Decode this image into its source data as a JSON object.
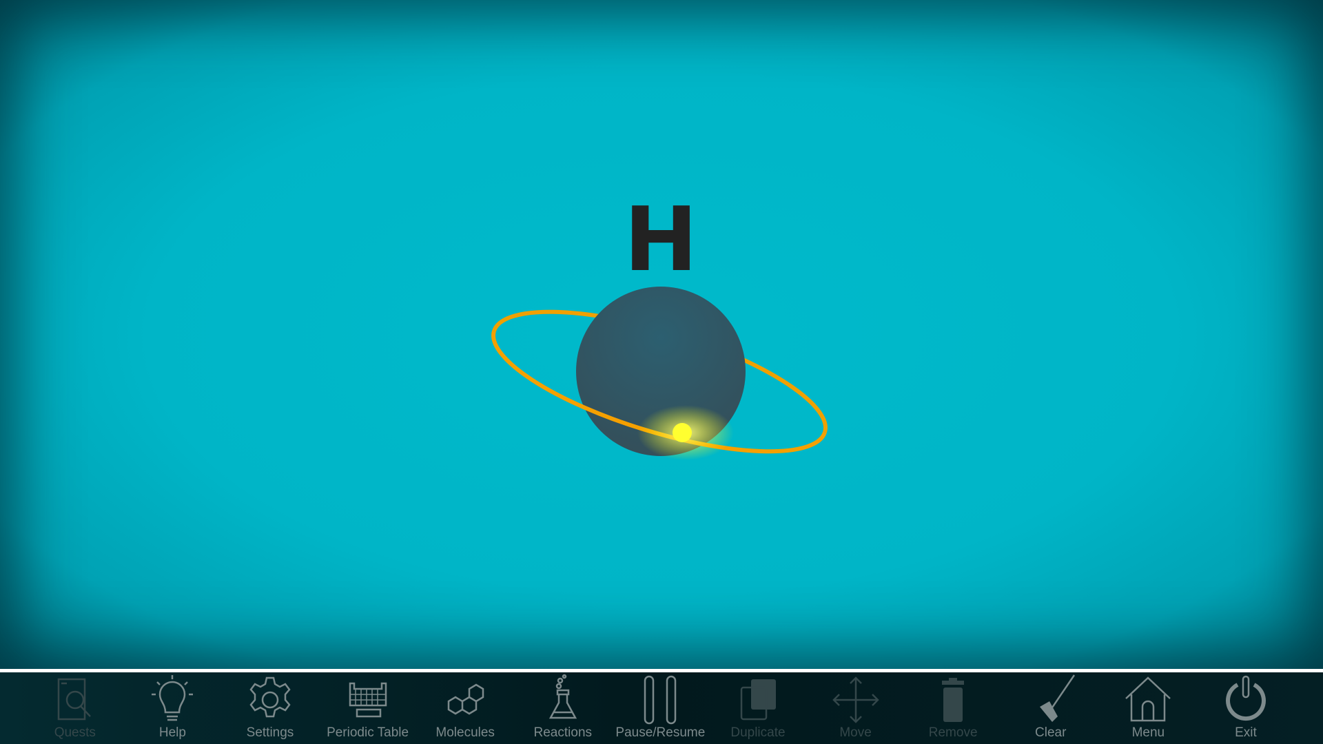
{
  "atom": {
    "symbol": "H",
    "orbit_color": "#f5a000",
    "electron_color": "#ffff20",
    "nucleus_color": "#2f5d6e"
  },
  "toolbar": {
    "items": [
      {
        "label": "Quests",
        "icon": "quest-book-icon",
        "enabled": false
      },
      {
        "label": "Help",
        "icon": "lightbulb-icon",
        "enabled": true
      },
      {
        "label": "Settings",
        "icon": "gear-icon",
        "enabled": true
      },
      {
        "label": "Periodic Table",
        "icon": "periodic-table-icon",
        "enabled": true
      },
      {
        "label": "Molecules",
        "icon": "molecule-icon",
        "enabled": true
      },
      {
        "label": "Reactions",
        "icon": "flask-icon",
        "enabled": true
      },
      {
        "label": "Pause/Resume",
        "icon": "pause-icon",
        "enabled": true
      },
      {
        "label": "Duplicate",
        "icon": "duplicate-icon",
        "enabled": false
      },
      {
        "label": "Move",
        "icon": "move-arrows-icon",
        "enabled": false
      },
      {
        "label": "Remove",
        "icon": "trash-icon",
        "enabled": false
      },
      {
        "label": "Clear",
        "icon": "mop-icon",
        "enabled": true
      },
      {
        "label": "Menu",
        "icon": "home-icon",
        "enabled": true
      },
      {
        "label": "Exit",
        "icon": "power-icon",
        "enabled": true
      }
    ]
  }
}
